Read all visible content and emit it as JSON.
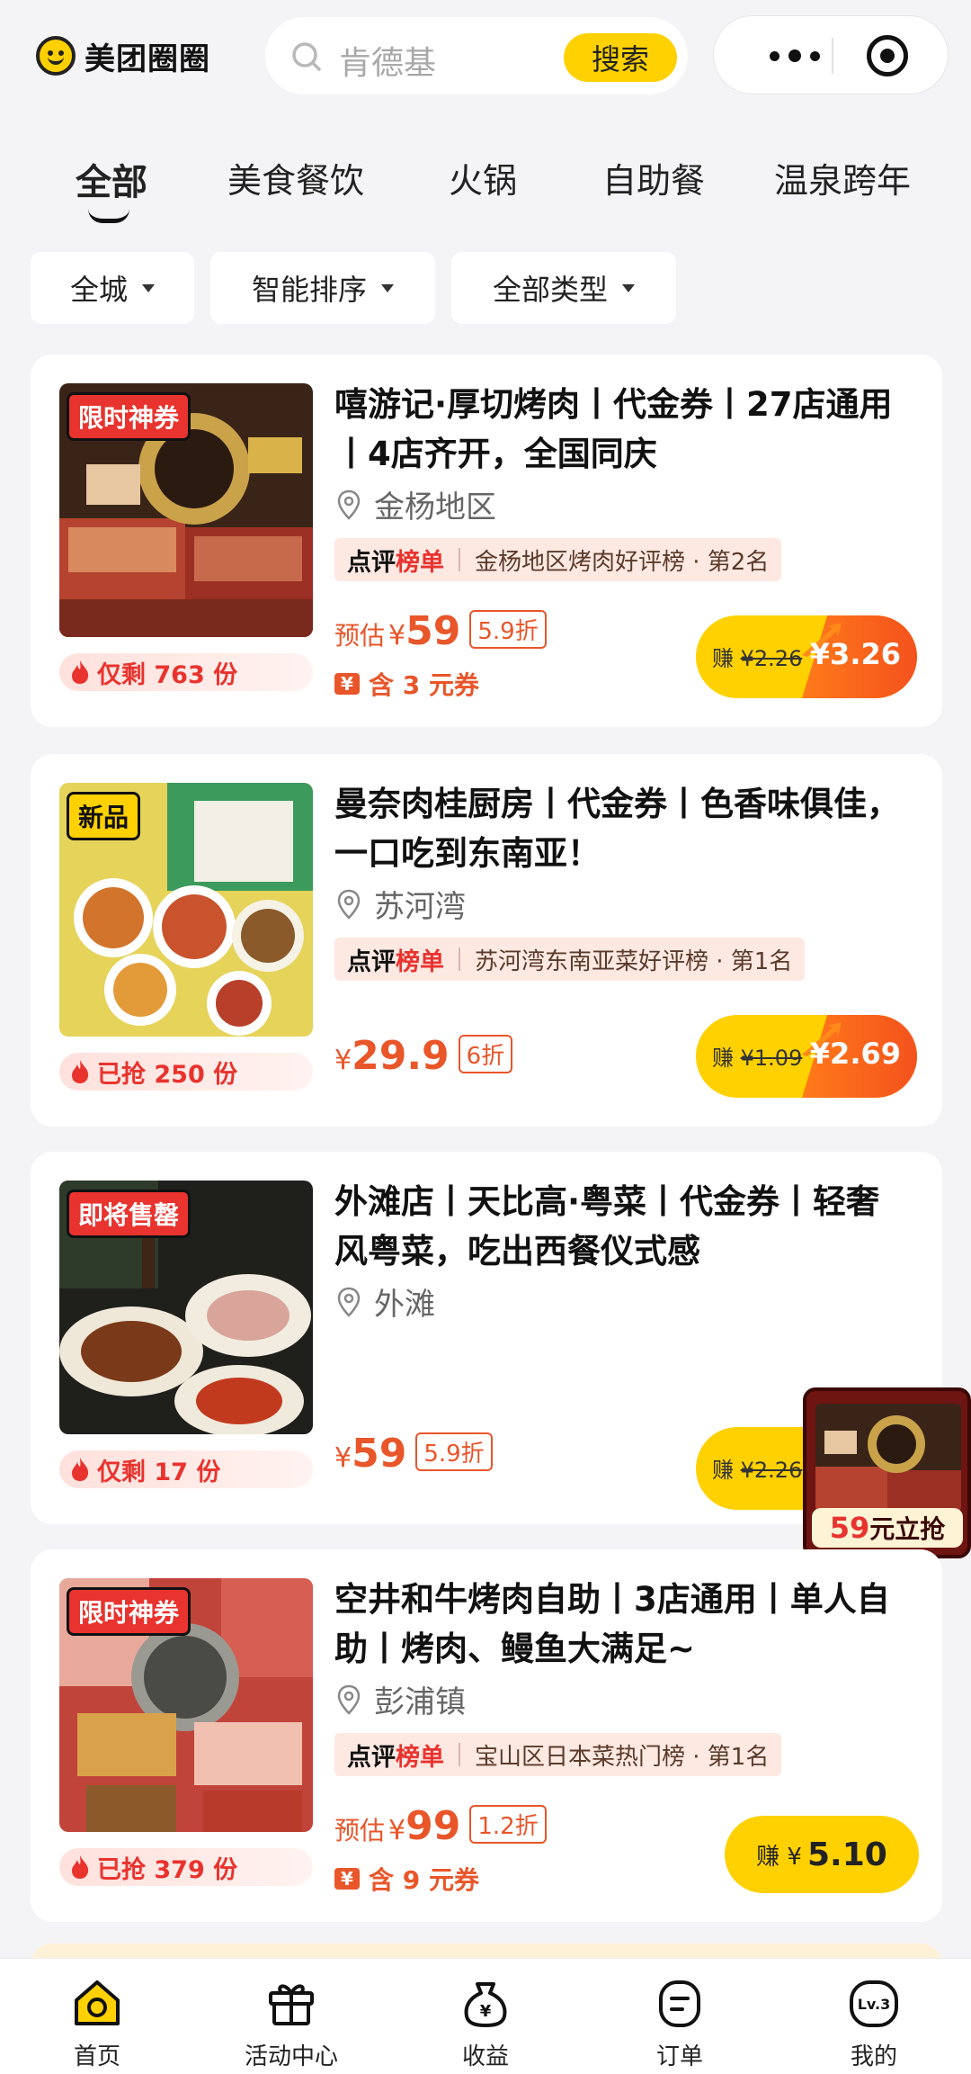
{
  "header": {
    "app_name": "美团圈圈",
    "search_placeholder": "肯德基",
    "search_button": "搜索"
  },
  "tabs": [
    "全部",
    "美食餐饮",
    "火锅",
    "自助餐",
    "温泉跨年"
  ],
  "filters": [
    "全城",
    "智能排序",
    "全部类型"
  ],
  "cards": [
    {
      "tag": "限时神券",
      "title": "嘻游记·厚切烤肉丨代金券丨27店通用丨4店齐开，全国同庆",
      "location": "金杨地区",
      "rank_title_a": "点评",
      "rank_title_b": "榜单",
      "rank_text": "金杨地区烤肉好评榜 · 第2名",
      "price_prefix": "预估",
      "yen": "¥",
      "price": "59",
      "discount": "5.9折",
      "coupon_icon": "¥",
      "coupon": "含 3 元券",
      "stock": "仅剩 763 份",
      "earn_label": "赚",
      "earn_old": "¥2.26",
      "earn_new": "¥3.26"
    },
    {
      "tag": "新品",
      "title": "曼奈肉桂厨房丨代金券丨色香味俱佳，一口吃到东南亚！",
      "location": "苏河湾",
      "rank_title_a": "点评",
      "rank_title_b": "榜单",
      "rank_text": "苏河湾东南亚菜好评榜 · 第1名",
      "yen": "¥",
      "price": "29.9",
      "discount": "6折",
      "stock": "已抢 250 份",
      "earn_label": "赚",
      "earn_old": "¥1.09",
      "earn_new": "¥2.69"
    },
    {
      "tag": "即将售罄",
      "title": "外滩店丨天比高·粤菜丨代金券丨轻奢风粤菜，吃出西餐仪式感",
      "location": "外滩",
      "yen": "¥",
      "price": "59",
      "discount": "5.9折",
      "stock": "仅剩 17 份",
      "earn_label": "赚",
      "earn_old": "¥2.26"
    },
    {
      "tag": "限时神券",
      "title": "空井和牛烤肉自助丨3店通用丨单人自助丨烤肉、鳗鱼大满足~",
      "location": "彭浦镇",
      "rank_title_a": "点评",
      "rank_title_b": "榜单",
      "rank_text": "宝山区日本菜热门榜 · 第1名",
      "price_prefix": "预估",
      "yen": "¥",
      "price": "99",
      "discount": "1.2折",
      "coupon_icon": "¥",
      "coupon": "含 9 元券",
      "stock": "已抢 379 份",
      "earn_label": "赚 ¥",
      "earn_value": "5.10"
    }
  ],
  "promo": {
    "price": "59",
    "text": "元立抢"
  },
  "nav": [
    "首页",
    "活动中心",
    "收益",
    "订单",
    "我的"
  ],
  "nav_level_badge": "Lv.3",
  "colors": {
    "brand_yellow": "#ffd100",
    "price_orange": "#e8562a",
    "tag_red": "#e8332e"
  }
}
